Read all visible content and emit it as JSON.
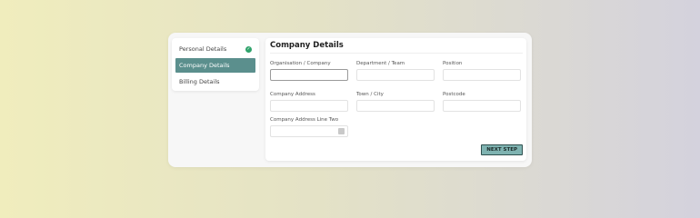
{
  "sidebar": {
    "items": [
      {
        "label": "Personal Details",
        "state": "completed"
      },
      {
        "label": "Company Details",
        "state": "active"
      },
      {
        "label": "Billing Details",
        "state": "pending"
      }
    ]
  },
  "form": {
    "title": "Company Details",
    "fields": {
      "organisation": {
        "label": "Organisation / Company",
        "value": ""
      },
      "department": {
        "label": "Department / Team",
        "value": ""
      },
      "position": {
        "label": "Position",
        "value": ""
      },
      "address": {
        "label": "Company Address",
        "value": ""
      },
      "town": {
        "label": "Town / City",
        "value": ""
      },
      "postcode": {
        "label": "Postcode",
        "value": ""
      },
      "address_two": {
        "label": "Company Address Line Two",
        "value": ""
      }
    },
    "next_label": "NEXT STEP"
  },
  "colors": {
    "accent": "#5b8f8d",
    "button": "#7fb3b1",
    "check": "#2fa36b"
  },
  "icons": {
    "completed": "check-circle-icon",
    "field_picker": "picker-icon"
  }
}
